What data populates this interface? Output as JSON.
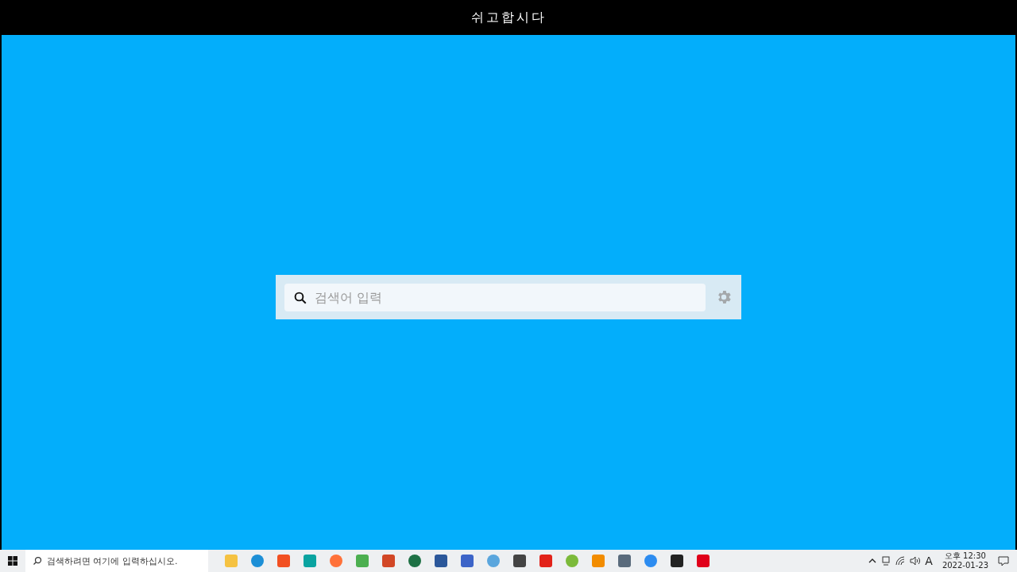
{
  "window": {
    "title": "쉬고합시다"
  },
  "search": {
    "placeholder": "검색어 입력"
  },
  "taskbar": {
    "search_placeholder": "검색하려면 여기에 입력하십시오.",
    "input_indicator": "A",
    "time": "오후 12:30",
    "date": "2022-01-23"
  }
}
